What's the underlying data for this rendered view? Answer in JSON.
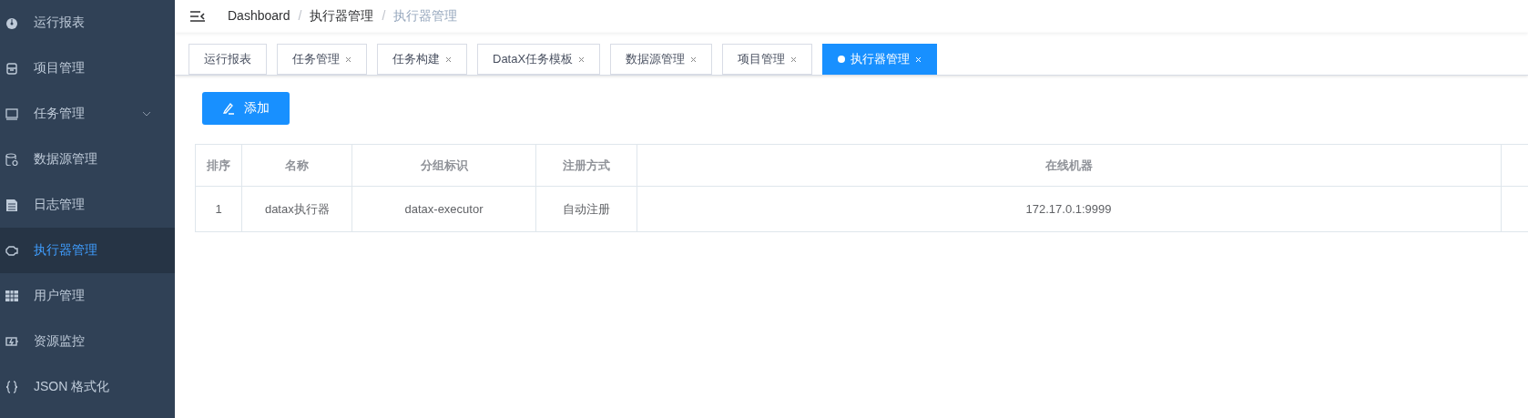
{
  "sidebar": {
    "items": [
      {
        "label": "运行报表",
        "selected": false,
        "expandable": false
      },
      {
        "label": "项目管理",
        "selected": false,
        "expandable": false
      },
      {
        "label": "任务管理",
        "selected": false,
        "expandable": true
      },
      {
        "label": "数据源管理",
        "selected": false,
        "expandable": false
      },
      {
        "label": "日志管理",
        "selected": false,
        "expandable": false
      },
      {
        "label": "执行器管理",
        "selected": true,
        "expandable": false
      },
      {
        "label": "用户管理",
        "selected": false,
        "expandable": false
      },
      {
        "label": "资源监控",
        "selected": false,
        "expandable": false
      },
      {
        "label": "JSON 格式化",
        "selected": false,
        "expandable": false
      }
    ]
  },
  "breadcrumb": {
    "separator": "/",
    "items": [
      "Dashboard",
      "执行器管理",
      "执行器管理"
    ]
  },
  "tabs": [
    {
      "label": "运行报表",
      "closable": false,
      "selected": false
    },
    {
      "label": "任务管理",
      "closable": true,
      "selected": false
    },
    {
      "label": "任务构建",
      "closable": true,
      "selected": false
    },
    {
      "label": "DataX任务模板",
      "closable": true,
      "selected": false
    },
    {
      "label": "数据源管理",
      "closable": true,
      "selected": false
    },
    {
      "label": "项目管理",
      "closable": true,
      "selected": false
    },
    {
      "label": "执行器管理",
      "closable": true,
      "selected": true
    }
  ],
  "add_button": "添加",
  "table": {
    "columns": [
      "排序",
      "名称",
      "分组标识",
      "注册方式",
      "在线机器"
    ],
    "rows": [
      [
        "1",
        "datax执行器",
        "datax-executor",
        "自动注册",
        "172.17.0.1:9999"
      ]
    ]
  }
}
